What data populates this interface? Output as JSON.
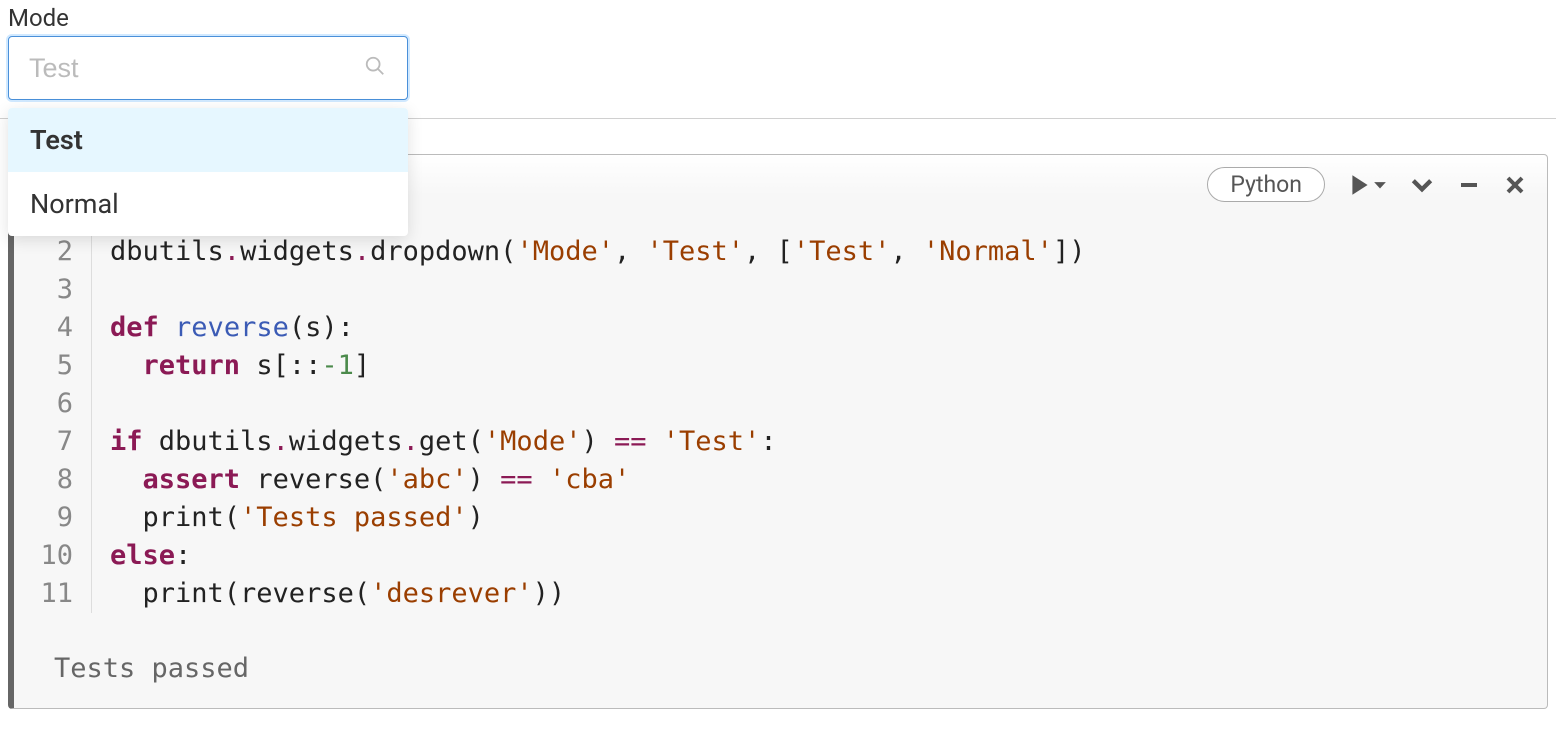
{
  "widget": {
    "label": "Mode",
    "placeholder": "Test",
    "value": "",
    "options": [
      "Test",
      "Normal"
    ],
    "selected": "Test"
  },
  "cell": {
    "language": "Python",
    "lines": [
      {
        "num": 2,
        "tokens": [
          {
            "t": "dbutils",
            "c": ""
          },
          {
            "t": ".",
            "c": "tok-op"
          },
          {
            "t": "widgets",
            "c": ""
          },
          {
            "t": ".",
            "c": "tok-op"
          },
          {
            "t": "dropdown",
            "c": ""
          },
          {
            "t": "(",
            "c": ""
          },
          {
            "t": "'Mode'",
            "c": "tok-str"
          },
          {
            "t": ", ",
            "c": ""
          },
          {
            "t": "'Test'",
            "c": "tok-str"
          },
          {
            "t": ", [",
            "c": ""
          },
          {
            "t": "'Test'",
            "c": "tok-str"
          },
          {
            "t": ", ",
            "c": ""
          },
          {
            "t": "'Normal'",
            "c": "tok-str"
          },
          {
            "t": "])",
            "c": ""
          }
        ]
      },
      {
        "num": 3,
        "tokens": []
      },
      {
        "num": 4,
        "tokens": [
          {
            "t": "def",
            "c": "tok-kw"
          },
          {
            "t": " ",
            "c": ""
          },
          {
            "t": "reverse",
            "c": "tok-fn"
          },
          {
            "t": "(s):",
            "c": ""
          }
        ]
      },
      {
        "num": 5,
        "tokens": [
          {
            "t": "  ",
            "c": ""
          },
          {
            "t": "return",
            "c": "tok-kw"
          },
          {
            "t": " s[::",
            "c": ""
          },
          {
            "t": "-1",
            "c": "tok-num"
          },
          {
            "t": "]",
            "c": ""
          }
        ]
      },
      {
        "num": 6,
        "tokens": []
      },
      {
        "num": 7,
        "tokens": [
          {
            "t": "if",
            "c": "tok-kw"
          },
          {
            "t": " dbutils",
            "c": ""
          },
          {
            "t": ".",
            "c": "tok-op"
          },
          {
            "t": "widgets",
            "c": ""
          },
          {
            "t": ".",
            "c": "tok-op"
          },
          {
            "t": "get(",
            "c": ""
          },
          {
            "t": "'Mode'",
            "c": "tok-str"
          },
          {
            "t": ") ",
            "c": ""
          },
          {
            "t": "==",
            "c": "tok-op"
          },
          {
            "t": " ",
            "c": ""
          },
          {
            "t": "'Test'",
            "c": "tok-str"
          },
          {
            "t": ":",
            "c": ""
          }
        ]
      },
      {
        "num": 8,
        "tokens": [
          {
            "t": "  ",
            "c": ""
          },
          {
            "t": "assert",
            "c": "tok-kw"
          },
          {
            "t": " reverse(",
            "c": ""
          },
          {
            "t": "'abc'",
            "c": "tok-str"
          },
          {
            "t": ") ",
            "c": ""
          },
          {
            "t": "==",
            "c": "tok-op"
          },
          {
            "t": " ",
            "c": ""
          },
          {
            "t": "'cba'",
            "c": "tok-str"
          }
        ]
      },
      {
        "num": 9,
        "tokens": [
          {
            "t": "  print(",
            "c": ""
          },
          {
            "t": "'Tests passed'",
            "c": "tok-str"
          },
          {
            "t": ")",
            "c": ""
          }
        ]
      },
      {
        "num": 10,
        "tokens": [
          {
            "t": "else",
            "c": "tok-kw"
          },
          {
            "t": ":",
            "c": ""
          }
        ]
      },
      {
        "num": 11,
        "tokens": [
          {
            "t": "  print(reverse(",
            "c": ""
          },
          {
            "t": "'desrever'",
            "c": "tok-str"
          },
          {
            "t": "))",
            "c": ""
          }
        ]
      }
    ],
    "output": "Tests passed"
  },
  "icons": {
    "run": "run-icon",
    "expand": "chevron-down-icon",
    "minimize": "minimize-icon",
    "close": "close-icon",
    "search": "search-icon"
  }
}
